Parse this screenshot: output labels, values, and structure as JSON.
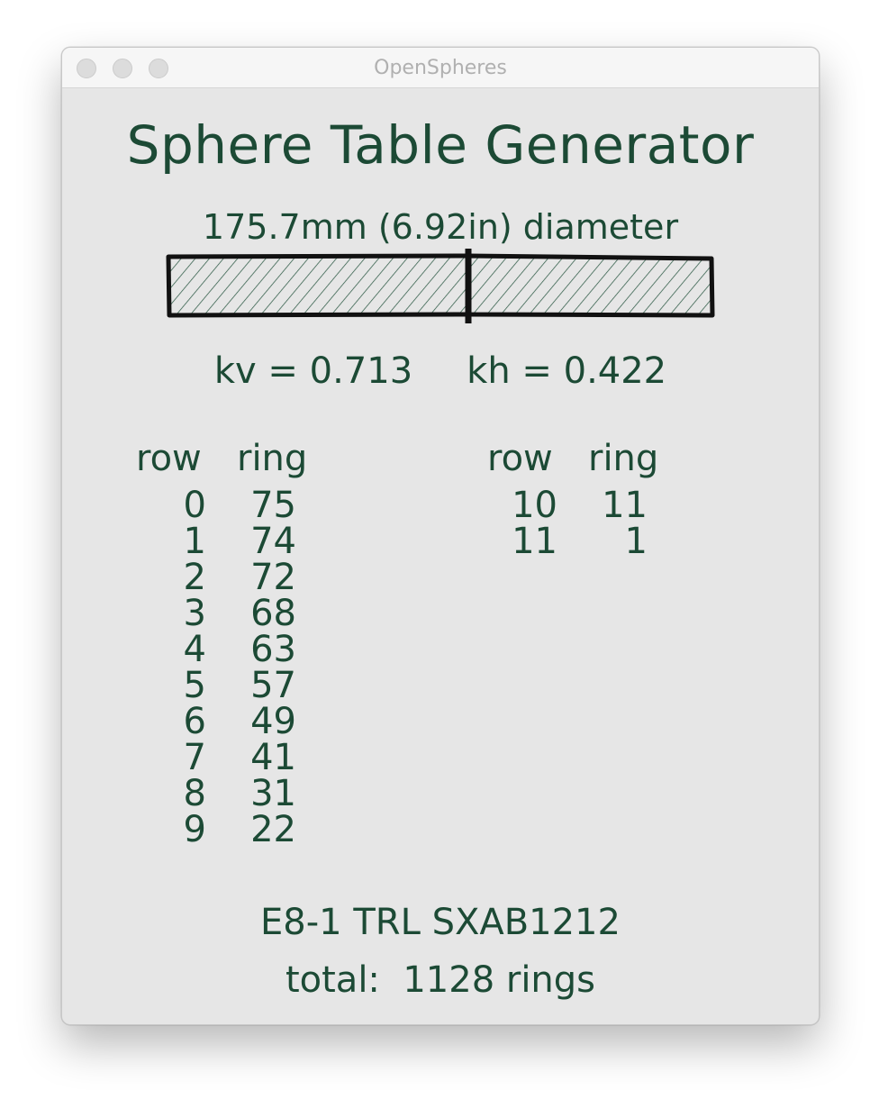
{
  "window": {
    "title": "OpenSpheres"
  },
  "heading": "Sphere Table Generator",
  "diameter_label": "175.7mm (6.92in) diameter",
  "k_values": {
    "kv": "kv = 0.713",
    "kh": "kh = 0.422"
  },
  "table": {
    "row_header": "row",
    "ring_header": "ring",
    "left_column": [
      {
        "row": "0",
        "ring": "75"
      },
      {
        "row": "1",
        "ring": "74"
      },
      {
        "row": "2",
        "ring": "72"
      },
      {
        "row": "3",
        "ring": "68"
      },
      {
        "row": "4",
        "ring": "63"
      },
      {
        "row": "5",
        "ring": "57"
      },
      {
        "row": "6",
        "ring": "49"
      },
      {
        "row": "7",
        "ring": "41"
      },
      {
        "row": "8",
        "ring": "31"
      },
      {
        "row": "9",
        "ring": "22"
      }
    ],
    "right_column": [
      {
        "row": "10",
        "ring": "11"
      },
      {
        "row": "11",
        "ring": "1"
      }
    ]
  },
  "code": "E8-1 TRL SXAB1212",
  "total_label": "total:",
  "total_value": "1128 rings",
  "colors": {
    "text": "#1c4a35",
    "window_bg": "#e6e6e6",
    "titlebar_bg": "#f6f6f6"
  },
  "icons": {
    "close": "traffic-light-close",
    "minimize": "traffic-light-minimize",
    "maximize": "traffic-light-maximize"
  }
}
